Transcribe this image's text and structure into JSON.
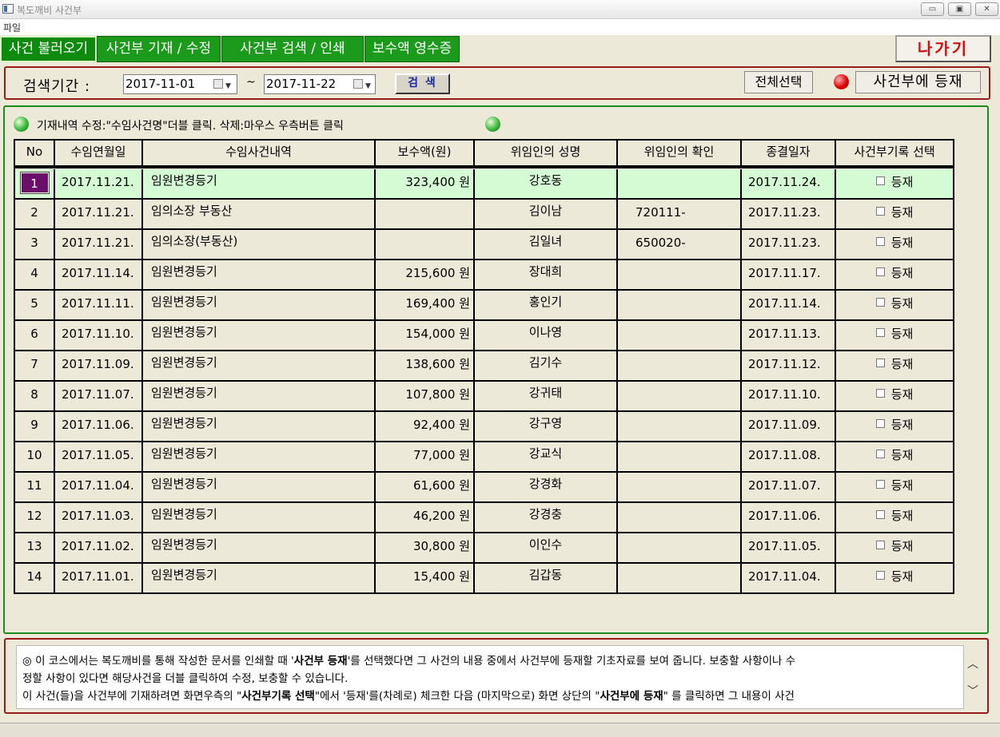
{
  "window": {
    "title": "복도깨비 사건부",
    "menu": [
      "파일"
    ]
  },
  "tabs": [
    {
      "label": "사건 불러오기",
      "active": true
    },
    {
      "label": "사건부 기재 / 수정",
      "active": false
    },
    {
      "label": "사건부 검색 / 인쇄",
      "active": false
    },
    {
      "label": "보수액 영수증",
      "active": false
    }
  ],
  "exit_label": "나가기",
  "search": {
    "label": "검색기간 :",
    "from": "2017-11-01",
    "to": "2017-11-22",
    "tilde": "~",
    "button": "검 색",
    "select_all": "전체선택",
    "register": "사건부에 등재"
  },
  "hint": "기재내역 수정:\"수임사건명\"더블 클릭. 삭제:마우스 우측버튼 클릭",
  "table": {
    "headers": [
      "No",
      "수임연월일",
      "수임사건내역",
      "보수액(원)",
      "위임인의 성명",
      "위임인의 확인",
      "종결일자",
      "사건부기록 선택"
    ],
    "checkbox_label": "등재",
    "rows": [
      [
        "1",
        "2017.11.21.",
        "임원변경등기",
        "323,400 원",
        "강호동",
        "",
        "2017.11.24."
      ],
      [
        "2",
        "2017.11.21.",
        "임의소장 부동산",
        "",
        "김이남",
        "720111-",
        "2017.11.23."
      ],
      [
        "3",
        "2017.11.21.",
        "임의소장(부동산)",
        "",
        "김일녀",
        "650020-",
        "2017.11.23."
      ],
      [
        "4",
        "2017.11.14.",
        "임원변경등기",
        "215,600 원",
        "장대희",
        "",
        "2017.11.17."
      ],
      [
        "5",
        "2017.11.11.",
        "임원변경등기",
        "169,400 원",
        "홍인기",
        "",
        "2017.11.14."
      ],
      [
        "6",
        "2017.11.10.",
        "임원변경등기",
        "154,000 원",
        "이나영",
        "",
        "2017.11.13."
      ],
      [
        "7",
        "2017.11.09.",
        "임원변경등기",
        "138,600 원",
        "김기수",
        "",
        "2017.11.12."
      ],
      [
        "8",
        "2017.11.07.",
        "임원변경등기",
        "107,800 원",
        "강귀태",
        "",
        "2017.11.10."
      ],
      [
        "9",
        "2017.11.06.",
        "임원변경등기",
        "92,400 원",
        "강구영",
        "",
        "2017.11.09."
      ],
      [
        "10",
        "2017.11.05.",
        "임원변경등기",
        "77,000 원",
        "강교식",
        "",
        "2017.11.08."
      ],
      [
        "11",
        "2017.11.04.",
        "임원변경등기",
        "61,600 원",
        "강경화",
        "",
        "2017.11.07."
      ],
      [
        "12",
        "2017.11.03.",
        "임원변경등기",
        "46,200 원",
        "강경충",
        "",
        "2017.11.06."
      ],
      [
        "13",
        "2017.11.02.",
        "임원변경등기",
        "30,800 원",
        "이인수",
        "",
        "2017.11.05."
      ],
      [
        "14",
        "2017.11.01.",
        "임원변경등기",
        "15,400 원",
        "김갑동",
        "",
        "2017.11.04."
      ]
    ]
  },
  "info": {
    "l1a": "◎ 이 코스에서는 복도깨비를 통해 작성한 문서를 인쇄할 때 '",
    "l1b": "사건부 등재",
    "l1c": "'를 선택했다면 그 사건의 내용 중에서 사건부에 등재할 기초자료를 보여 줍니다. 보충할 사항이나 수",
    "l2": "정할 사항이 있다면 해당사건을 더블 클릭하여 수정, 보충할 수 있습니다.",
    "l3a": "이 사건(들)을 사건부에 기재하려면 화면우측의 \"",
    "l3b": "사건부기록 선택",
    "l3c": "\"에서 '등재'를(차례로) 체크한 다음 (마지막으로) 화면 상단의 \"",
    "l3d": "사건부에 등재",
    "l3e": "\" 를 클릭하면 그 내용이 사건"
  }
}
